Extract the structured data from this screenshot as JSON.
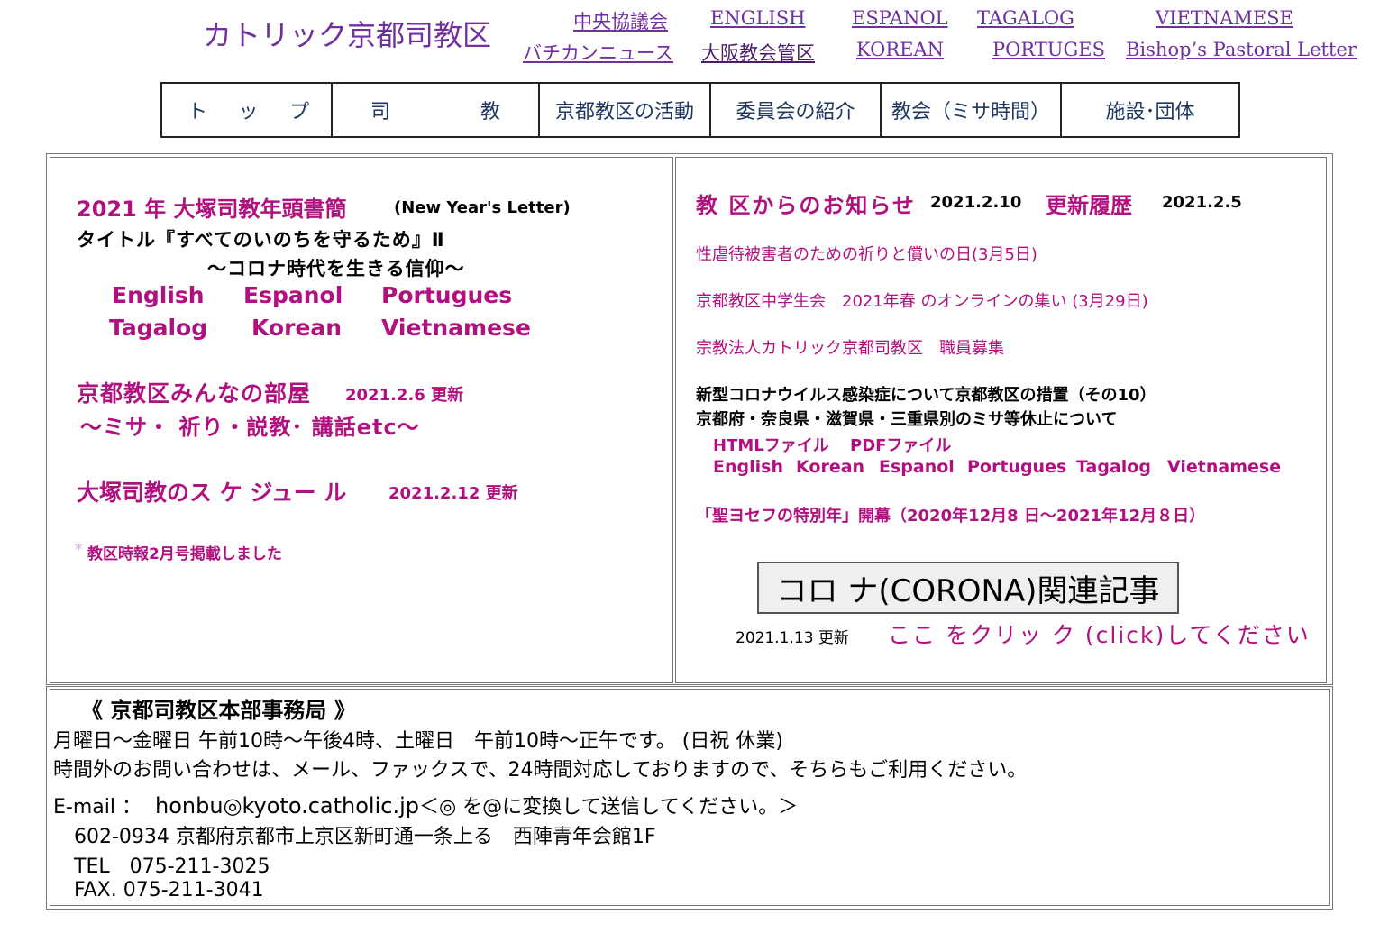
{
  "header": {
    "site_title": "カトリック京都司教区",
    "links_row1": [
      "中央協議会",
      "ENGLISH",
      "ESPANOL",
      "TAGALOG",
      "VIETNAMESE"
    ],
    "links_row2": [
      "バチカンニュース",
      "大阪教会管区",
      "KOREAN",
      "PORTUGES",
      "Bishop’s Pastoral Letter"
    ]
  },
  "nav": {
    "top": [
      "ト",
      "ッ",
      "プ"
    ],
    "bishop": [
      "司",
      "教"
    ],
    "activities": "京都教区の活動",
    "committees": "委員会の紹介",
    "churches": "教会（ミサ時間）",
    "facilities": "施設･団体"
  },
  "left": {
    "letter_title": "2021 年 大塚司教年頭書簡",
    "letter_en": "(New Year's Letter)",
    "letter_subtitle": "タイトル『すべてのいのちを守るため』Ⅱ",
    "letter_subtitle2": "～コロナ時代を生きる信仰～",
    "langs": [
      "English",
      "Espanol",
      "Portugues",
      "Tagalog",
      "Korean",
      "Vietnamese"
    ],
    "room_title": "京都教区みんなの部屋",
    "room_date": "2021.2.6 更新",
    "room_sub": "～ミサ・ 祈り・説教･ 講話etc～",
    "schedule_title": "大塚司教のス ケ ジュー ル",
    "schedule_date": "2021.2.12 更新",
    "bulletin_star": "*",
    "bulletin": "教区時報2月号掲載しました"
  },
  "right": {
    "notice_title": "教 区からのお知らせ",
    "notice_date": "2021.2.10",
    "history_title": "更新履歴",
    "history_date": "2021.2.5",
    "items": [
      "性虐待被害者のための祈りと償いの日(3月5日)",
      "京都教区中学生会　2021年春 のオンラインの集い (3月29日)",
      "宗教法人カトリック京都司教区　職員募集"
    ],
    "covid_line1": "新型コロナウイルス感染症について京都教区の措置（その10）",
    "covid_line2": "京都府・奈良県・滋賀県・三重県別のミサ等休止について",
    "file_html": "HTMLファイル",
    "file_pdf": "PDFファイル",
    "covid_langs": [
      "English",
      "Korean",
      "Espanol",
      "Portugues",
      "Tagalog",
      "Vietnamese"
    ],
    "joseph_year": "「聖ヨセフの特別年」開幕（2020年12月8 日～2021年12月８日）",
    "corona_button": "コロ ナ(CORONA)関連記事",
    "corona_updated": "2021.1.13 更新",
    "corona_click": "ここ をクリッ ク (click)してください"
  },
  "office": {
    "title": "《 京都司教区本部事務局 》",
    "hours": "月曜日～金曜日 午前10時～午後4時、土曜日　午前10時～正午です。 (日祝 休業)",
    "after_hours": "時間外のお問い合わせは、メール、ファックスで、24時間対応しておりますので、そちらもご利用ください。",
    "email_label": "E-mail ：",
    "email": "honbu◎kyoto.catholic.jp",
    "email_note": "＜◎ を@に変換して送信してください。＞",
    "address": "602-0934 京都府京都市上京区新町通一条上る　西陣青年会館1F",
    "tel": "TEL　075-211-3025",
    "fax": "FAX. 075-211-3041"
  },
  "colors": {
    "accent": "#b0117f",
    "title": "#7030a0",
    "nav_text": "#1f3864"
  }
}
